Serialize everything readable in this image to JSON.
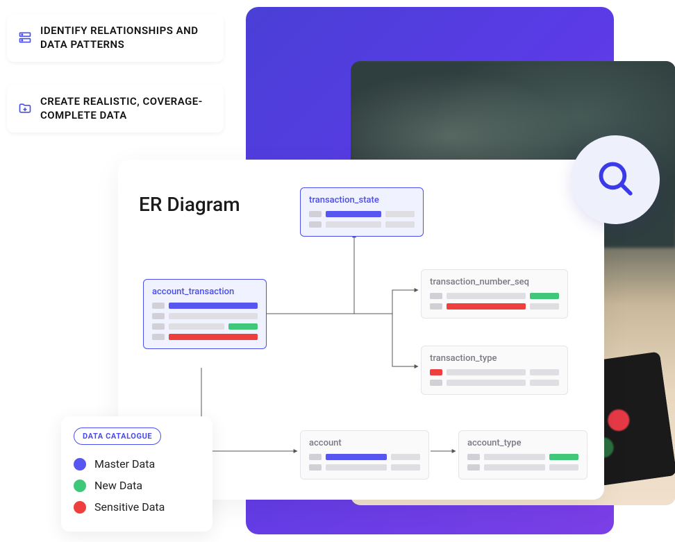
{
  "callouts": {
    "identify": "IDENTIFY RELATIONSHIPS AND DATA PATTERNS",
    "create": "CREATE REALISTIC, COVERAGE-COMPLETE DATA"
  },
  "er": {
    "title": "ER Diagram",
    "entities": {
      "account_transaction": "account_transaction",
      "transaction_state": "transaction_state",
      "transaction_number_seq": "transaction_number_seq",
      "transaction_type": "transaction_type",
      "account": "account",
      "account_type": "account_type"
    }
  },
  "legend": {
    "title": "DATA CATALOGUE",
    "items": {
      "master": "Master Data",
      "new": "New Data",
      "sensitive": "Sensitive Data"
    }
  },
  "icons": {
    "magnifier": "search-icon",
    "server": "server-icon",
    "add_folder": "add-folder-icon"
  },
  "colors": {
    "primary": "#4a4df0",
    "master": "#5856f0",
    "new": "#3fc77a",
    "sensitive": "#ef3e3e"
  }
}
